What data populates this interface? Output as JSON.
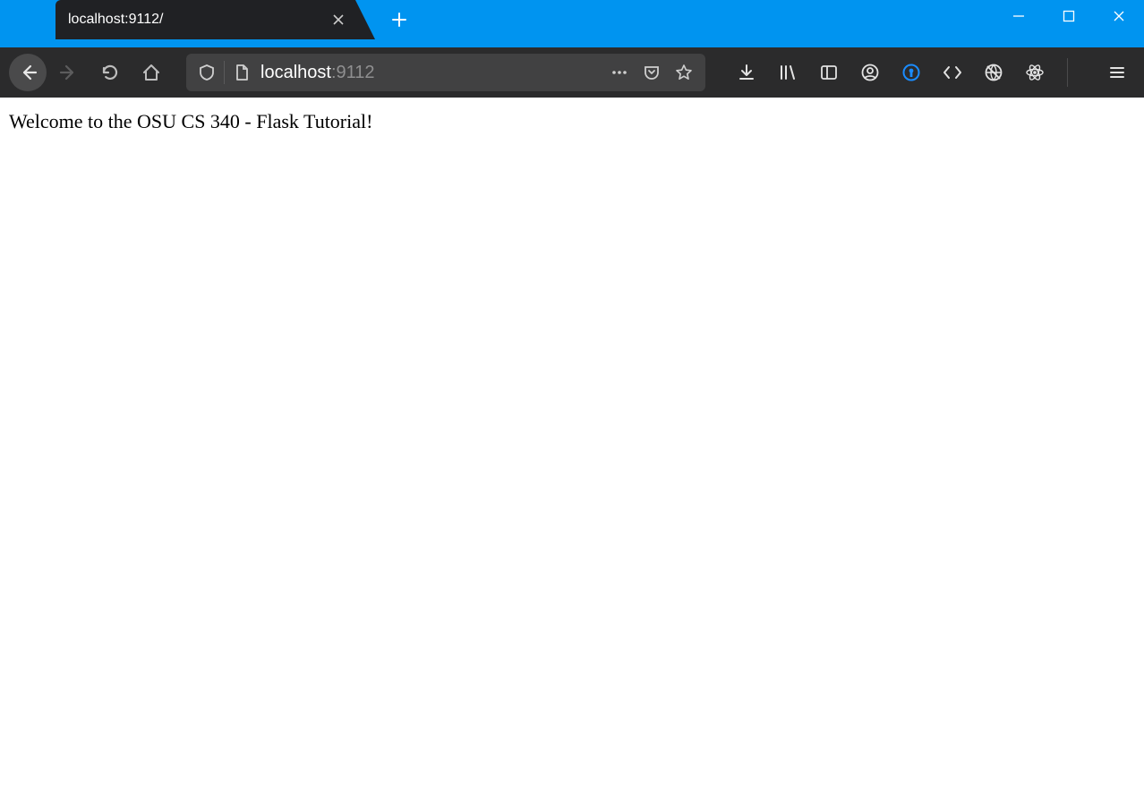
{
  "window": {
    "tab_title": "localhost:9112/"
  },
  "urlbar": {
    "host": "localhost",
    "port": ":9112"
  },
  "page": {
    "body_text": "Welcome to the OSU CS 340 - Flask Tutorial!"
  }
}
